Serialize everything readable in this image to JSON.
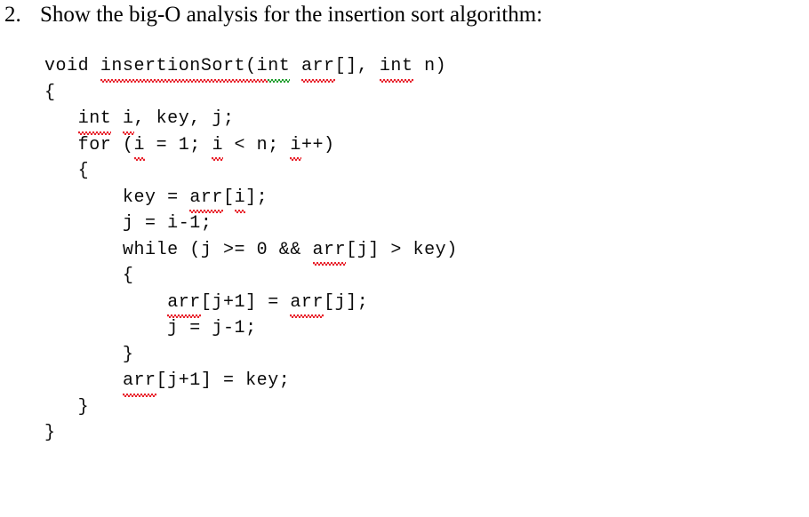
{
  "question": {
    "number": "2.",
    "text": "Show the big-O analysis for the insertion sort algorithm:"
  },
  "code": {
    "language": "c",
    "lines": [
      {
        "id": "line-1",
        "text": "void insertionSort(int arr[], int n)",
        "segments": [
          {
            "t": "void ",
            "mark": "none"
          },
          {
            "t": "insertionSort(i",
            "mark": "spell"
          },
          {
            "t": "nt",
            "mark": "grammar"
          },
          {
            "t": " ",
            "mark": "none"
          },
          {
            "t": "arr",
            "mark": "spell"
          },
          {
            "t": "[], ",
            "mark": "none"
          },
          {
            "t": "int",
            "mark": "spell"
          },
          {
            "t": " n)",
            "mark": "none"
          }
        ]
      },
      {
        "id": "line-2",
        "text": "{",
        "segments": [
          {
            "t": "{",
            "mark": "none"
          }
        ]
      },
      {
        "id": "line-3",
        "text": "   int i, key, j;",
        "segments": [
          {
            "t": "   ",
            "mark": "none"
          },
          {
            "t": "int",
            "mark": "spell"
          },
          {
            "t": " ",
            "mark": "none"
          },
          {
            "t": "i",
            "mark": "spell"
          },
          {
            "t": ", key, j;",
            "mark": "none"
          }
        ]
      },
      {
        "id": "line-4",
        "text": "   for (i = 1; i < n; i++)",
        "segments": [
          {
            "t": "   for (",
            "mark": "none"
          },
          {
            "t": "i",
            "mark": "spell"
          },
          {
            "t": " = 1; ",
            "mark": "none"
          },
          {
            "t": "i",
            "mark": "spell"
          },
          {
            "t": " < n; ",
            "mark": "none"
          },
          {
            "t": "i",
            "mark": "spell"
          },
          {
            "t": "++)",
            "mark": "none"
          }
        ]
      },
      {
        "id": "line-5",
        "text": "   {",
        "segments": [
          {
            "t": "   {",
            "mark": "none"
          }
        ]
      },
      {
        "id": "line-6",
        "text": "       key = arr[i];",
        "segments": [
          {
            "t": "       key = ",
            "mark": "none"
          },
          {
            "t": "arr",
            "mark": "spell"
          },
          {
            "t": "[",
            "mark": "none"
          },
          {
            "t": "i",
            "mark": "spell"
          },
          {
            "t": "];",
            "mark": "none"
          }
        ]
      },
      {
        "id": "line-7",
        "text": "       j = i-1;",
        "segments": [
          {
            "t": "       j = i-1;",
            "mark": "none"
          }
        ]
      },
      {
        "id": "line-8",
        "text": "       while (j >= 0 && arr[j] > key)",
        "segments": [
          {
            "t": "       while (j >= 0 && ",
            "mark": "none"
          },
          {
            "t": "arr",
            "mark": "spell"
          },
          {
            "t": "[j] > key)",
            "mark": "none"
          }
        ]
      },
      {
        "id": "line-9",
        "text": "       {",
        "segments": [
          {
            "t": "       {",
            "mark": "none"
          }
        ]
      },
      {
        "id": "line-10",
        "text": "           arr[j+1] = arr[j];",
        "segments": [
          {
            "t": "           ",
            "mark": "none"
          },
          {
            "t": "arr",
            "mark": "spell"
          },
          {
            "t": "[j+1] = ",
            "mark": "none"
          },
          {
            "t": "arr",
            "mark": "spell"
          },
          {
            "t": "[j];",
            "mark": "none"
          }
        ]
      },
      {
        "id": "line-11",
        "text": "           j = j-1;",
        "segments": [
          {
            "t": "           j = j-1;",
            "mark": "none"
          }
        ]
      },
      {
        "id": "line-12",
        "text": "       }",
        "segments": [
          {
            "t": "       }",
            "mark": "none"
          }
        ]
      },
      {
        "id": "line-13",
        "text": "       arr[j+1] = key;",
        "segments": [
          {
            "t": "       ",
            "mark": "none"
          },
          {
            "t": "arr",
            "mark": "spell"
          },
          {
            "t": "[j+1] = key;",
            "mark": "none"
          }
        ]
      },
      {
        "id": "line-14",
        "text": "   }",
        "segments": [
          {
            "t": "   }",
            "mark": "none"
          }
        ]
      },
      {
        "id": "line-15",
        "text": "}",
        "segments": [
          {
            "t": "}",
            "mark": "none"
          }
        ]
      }
    ]
  },
  "colors": {
    "background": "#ffffff",
    "text": "#000000",
    "spell_underline": "#e8202a",
    "grammar_underline": "#1f9e2e"
  }
}
